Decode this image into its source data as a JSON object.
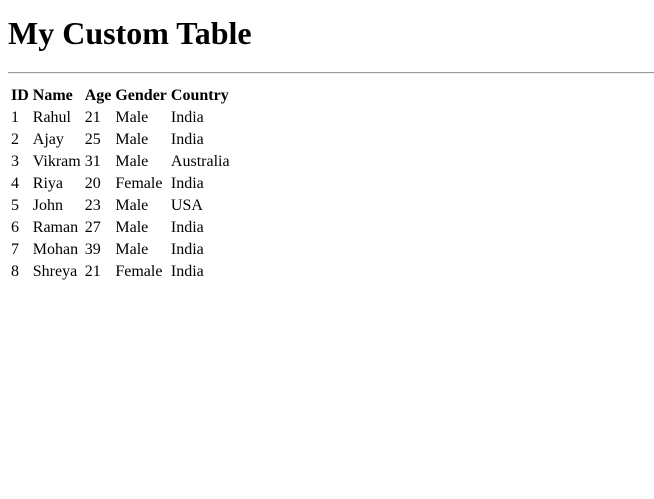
{
  "page": {
    "title": "My Custom Table"
  },
  "table": {
    "headers": [
      "ID",
      "Name",
      "Age",
      "Gender",
      "Country"
    ],
    "rows": [
      [
        "1",
        "Rahul",
        "21",
        "Male",
        "India"
      ],
      [
        "2",
        "Ajay",
        "25",
        "Male",
        "India"
      ],
      [
        "3",
        "Vikram",
        "31",
        "Male",
        "Australia"
      ],
      [
        "4",
        "Riya",
        "20",
        "Female",
        "India"
      ],
      [
        "5",
        "John",
        "23",
        "Male",
        "USA"
      ],
      [
        "6",
        "Raman",
        "27",
        "Male",
        "India"
      ],
      [
        "7",
        "Mohan",
        "39",
        "Male",
        "India"
      ],
      [
        "8",
        "Shreya",
        "21",
        "Female",
        "India"
      ]
    ]
  }
}
